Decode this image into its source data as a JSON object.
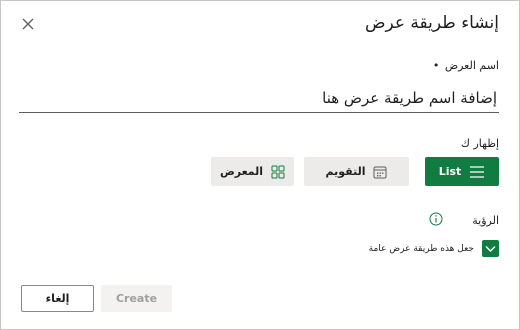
{
  "dialog": {
    "title": "إنشاء طريقة عرض"
  },
  "name_field": {
    "label": "اسم العرض",
    "required_mark": "•",
    "placeholder": "إضافة اسم طريقة عرض هنا"
  },
  "show_as": {
    "label": "إظهار ك",
    "options": [
      {
        "label": "List",
        "icon": "list-icon",
        "selected": true
      },
      {
        "label": "التقويم",
        "icon": "calendar-icon",
        "selected": false
      },
      {
        "label": "المعرض",
        "icon": "gallery-grid-icon",
        "selected": false
      }
    ]
  },
  "visibility": {
    "label": "الرؤية",
    "info_icon": "info-icon",
    "checkbox_label": "جعل هذه طريقة عرض عامة",
    "checked": true
  },
  "footer": {
    "create_label": "Create",
    "cancel_label": "إلغاء"
  },
  "colors": {
    "accent": "#107c41",
    "secondary_button": "#edebe9",
    "disabled_text": "#a19f9d"
  }
}
